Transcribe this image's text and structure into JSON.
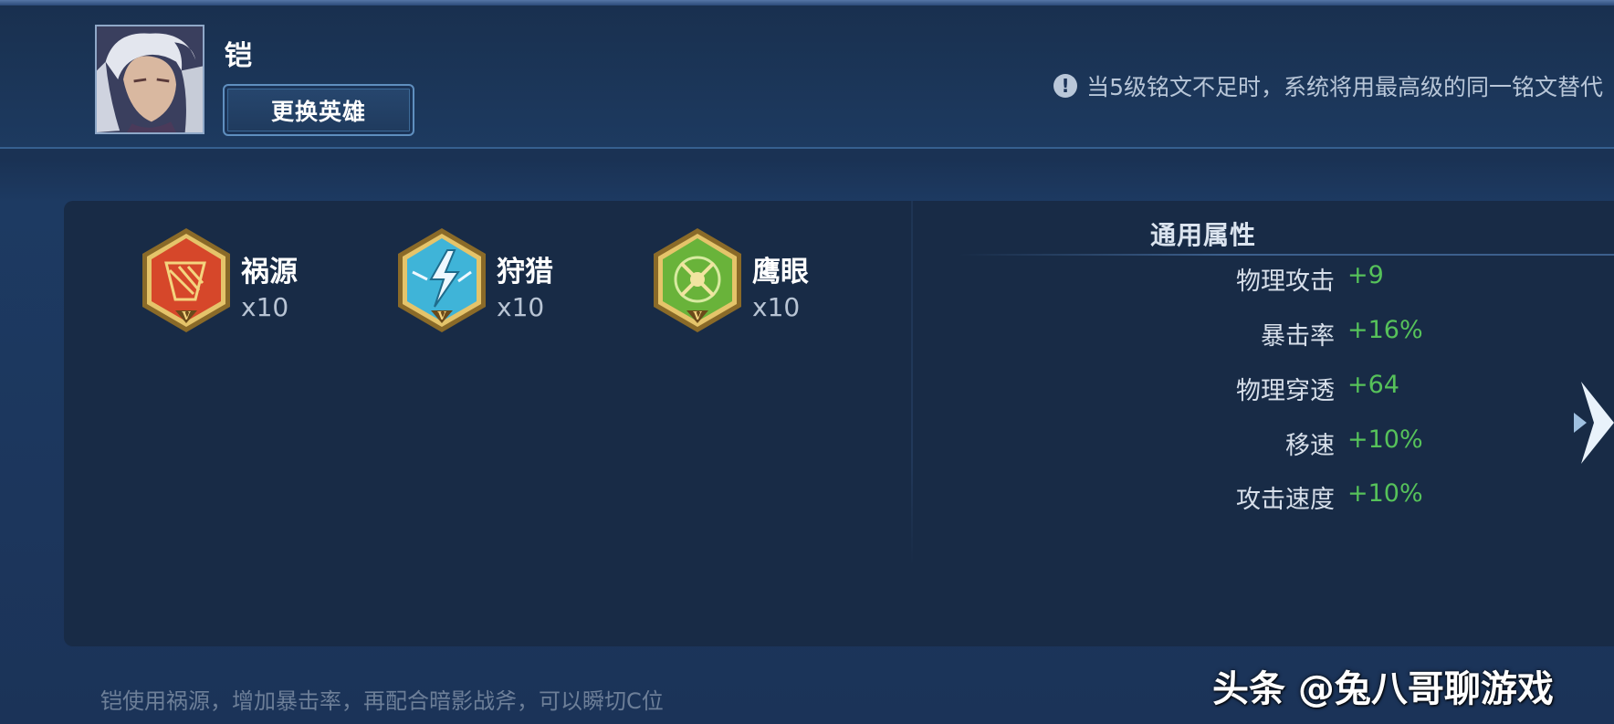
{
  "hero": {
    "name": "铠",
    "change_button_label": "更换英雄"
  },
  "notice": {
    "icon": "exclamation-icon",
    "icon_glyph": "!",
    "text": "当5级铭文不足时，系统将用最高级的同一铭文替代"
  },
  "runes": [
    {
      "name": "祸源",
      "count": "x10",
      "icon": "huoyuan-rune-icon",
      "color": "#d6472a",
      "level_mark": "V"
    },
    {
      "name": "狩猎",
      "count": "x10",
      "icon": "shoulie-rune-icon",
      "color": "#3fb4d8",
      "level_mark": "V"
    },
    {
      "name": "鹰眼",
      "count": "x10",
      "icon": "yingyan-rune-icon",
      "color": "#69b33a",
      "level_mark": "V"
    }
  ],
  "attributes": {
    "title": "通用属性",
    "items": [
      {
        "label": "物理攻击",
        "value": "+9"
      },
      {
        "label": "暴击率",
        "value": "+16%"
      },
      {
        "label": "物理穿透",
        "value": "+64"
      },
      {
        "label": "移速",
        "value": "+10%"
      },
      {
        "label": "攻击速度",
        "value": "+10%"
      }
    ]
  },
  "footer": {
    "note": "铠使用祸源，增加暴击率，再配合暗影战斧，可以瞬切C位"
  },
  "watermark": {
    "text": "头条 @兔八哥聊游戏"
  },
  "colors": {
    "accent_green": "#56c25a",
    "background": "#1b3358",
    "panel": "#182b46"
  }
}
